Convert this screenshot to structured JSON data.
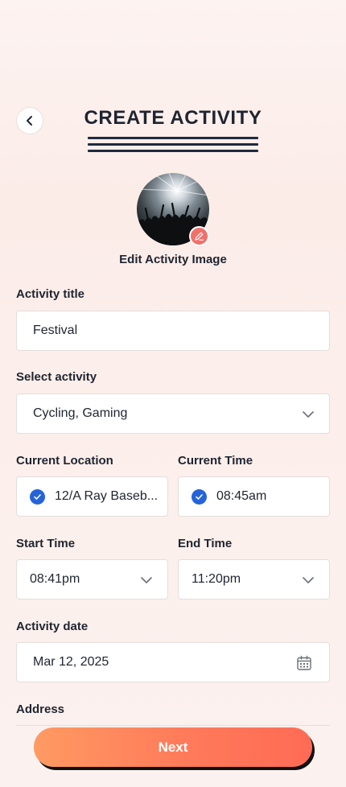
{
  "header": {
    "title": "CREATE ACTIVITY",
    "back_icon": "chevron-left-icon"
  },
  "activity_image": {
    "edit_label": "Edit Activity Image",
    "edit_icon": "pencil-icon"
  },
  "form": {
    "activity_title": {
      "label": "Activity title",
      "value": "Festival"
    },
    "select_activity": {
      "label": "Select activity",
      "value": "Cycling, Gaming"
    },
    "current_location": {
      "label": "Current Location",
      "value": "12/A Ray Baseb..."
    },
    "current_time": {
      "label": "Current Time",
      "value": "08:45am"
    },
    "start_time": {
      "label": "Start Time",
      "value": "08:41pm"
    },
    "end_time": {
      "label": "End Time",
      "value": "11:20pm"
    },
    "activity_date": {
      "label": "Activity date",
      "value": "Mar 12, 2025"
    },
    "address": {
      "label": "Address"
    }
  },
  "footer": {
    "next_label": "Next"
  },
  "colors": {
    "accent_start": "#ff9a62",
    "accent_end": "#ff6b55",
    "check_blue": "#2563d9",
    "edit_badge": "#f2706a",
    "text_dark": "#1f2430"
  }
}
